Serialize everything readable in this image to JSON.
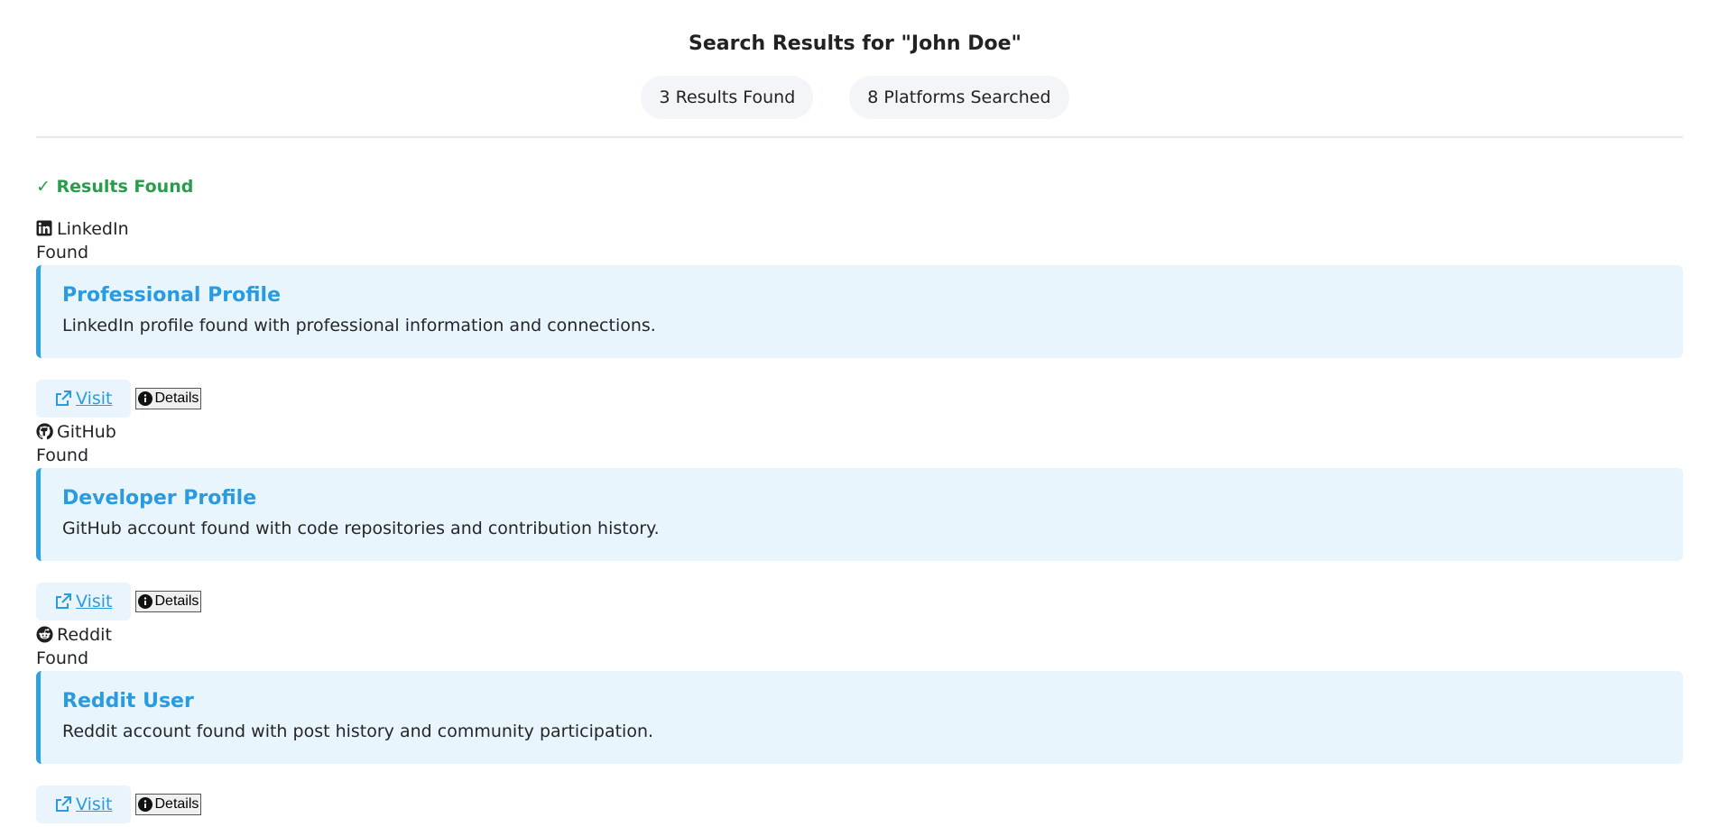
{
  "header": {
    "title": "Search Results for \"John Doe\"",
    "results_found": "3 Results Found",
    "platforms_searched": "8 Platforms Searched"
  },
  "section": {
    "title": "✓ Results Found"
  },
  "results": [
    {
      "platform": "LinkedIn",
      "icon": "linkedin-icon",
      "status": "Found",
      "card_title": "Professional Profile",
      "card_description": "LinkedIn profile found with professional information and connections.",
      "visit_label": "Visit",
      "details_label": "Details"
    },
    {
      "platform": "GitHub",
      "icon": "github-icon",
      "status": "Found",
      "card_title": "Developer Profile",
      "card_description": "GitHub account found with code repositories and contribution history.",
      "visit_label": "Visit",
      "details_label": "Details"
    },
    {
      "platform": "Reddit",
      "icon": "reddit-icon",
      "status": "Found",
      "card_title": "Reddit User",
      "card_description": "Reddit account found with post history and community participation.",
      "visit_label": "Visit",
      "details_label": "Details"
    }
  ],
  "colors": {
    "accent": "#2a9be0",
    "success": "#2a9d4b",
    "card_bg": "#e9f5fd"
  }
}
